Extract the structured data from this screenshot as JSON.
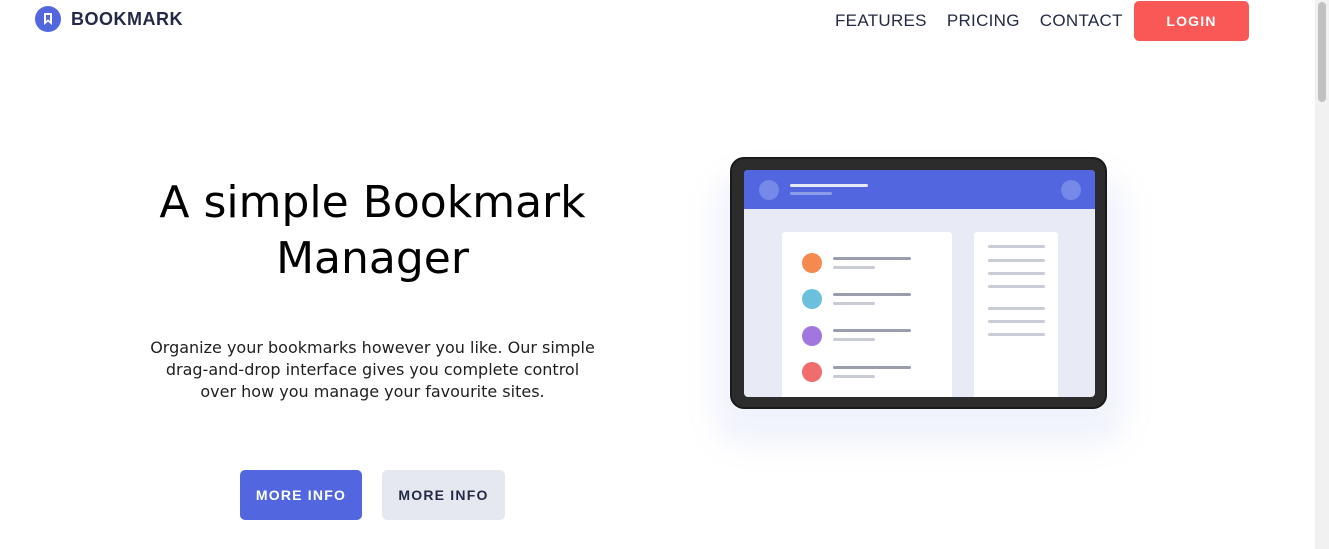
{
  "header": {
    "brand": "BOOKMARK",
    "nav": [
      "FEATURES",
      "PRICING",
      "CONTACT"
    ],
    "login_label": "LOGIN"
  },
  "hero": {
    "title_line1": "A simple Bookmark",
    "title_line2": "Manager",
    "description_line1": "Organize your bookmarks however you like. Our simple",
    "description_line2": "drag-and-drop interface gives you complete control",
    "description_line3": "over how you manage your favourite sites.",
    "primary_button": "MORE INFO",
    "secondary_button": "MORE INFO"
  },
  "illustration": {
    "list_dot_colors": [
      "#f5894f",
      "#6bc0dd",
      "#a176df",
      "#ef6d6d"
    ]
  },
  "colors": {
    "accent": "#5267df",
    "login": "#fa5757",
    "text": "#242a45"
  }
}
